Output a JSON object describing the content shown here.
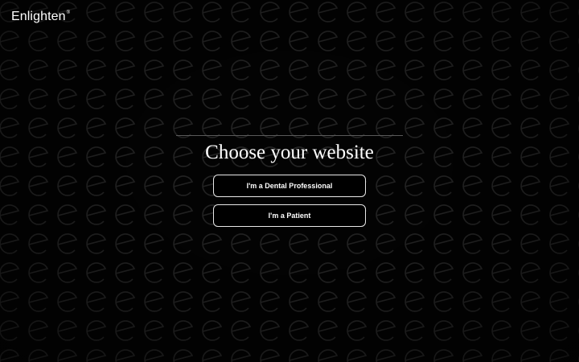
{
  "brand": {
    "name": "Enlighten",
    "registered_mark": "®"
  },
  "main": {
    "heading": "Choose your website",
    "options": [
      {
        "label": "I'm a Dental Professional"
      },
      {
        "label": "I'm a Patient"
      }
    ]
  },
  "colors": {
    "background": "#000000",
    "pattern_stroke": "#262626",
    "text": "#ffffff",
    "button_border": "#e8e8e8",
    "divider": "#5a5a5a"
  },
  "icons": {
    "background_pattern": "enlighten-e-monogram-icon"
  }
}
